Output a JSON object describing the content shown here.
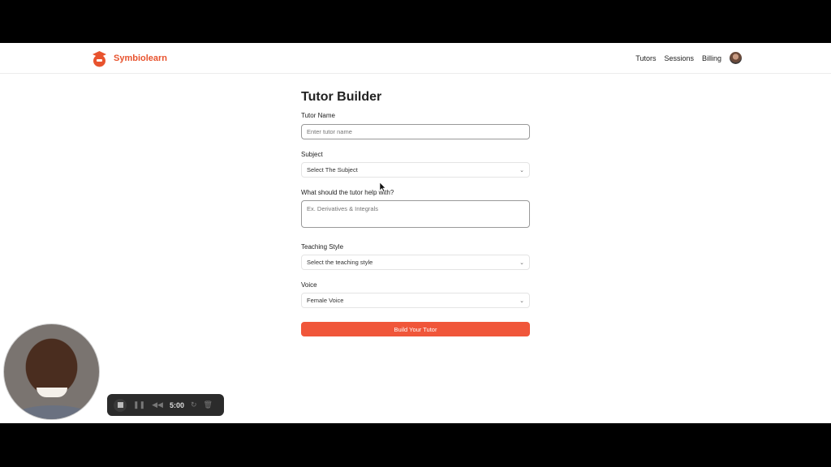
{
  "app": {
    "brand": "Symbiolearn",
    "brand_color": "#e8532e"
  },
  "nav": {
    "items": [
      "Tutors",
      "Sessions",
      "Billing"
    ]
  },
  "form": {
    "title": "Tutor Builder",
    "tutor_name": {
      "label": "Tutor Name",
      "placeholder": "Enter tutor name",
      "value": ""
    },
    "subject": {
      "label": "Subject",
      "value": "Select The Subject"
    },
    "help_with": {
      "label": "What should the tutor help with?",
      "placeholder": "Ex. Derivatives & Integrals"
    },
    "teaching_style": {
      "label": "Teaching Style",
      "value": "Select the teaching style"
    },
    "voice": {
      "label": "Voice",
      "value": "Female Voice"
    },
    "submit_label": "Build Your Tutor",
    "submit_color": "#f0563a"
  },
  "recorder": {
    "time": "5:00"
  }
}
